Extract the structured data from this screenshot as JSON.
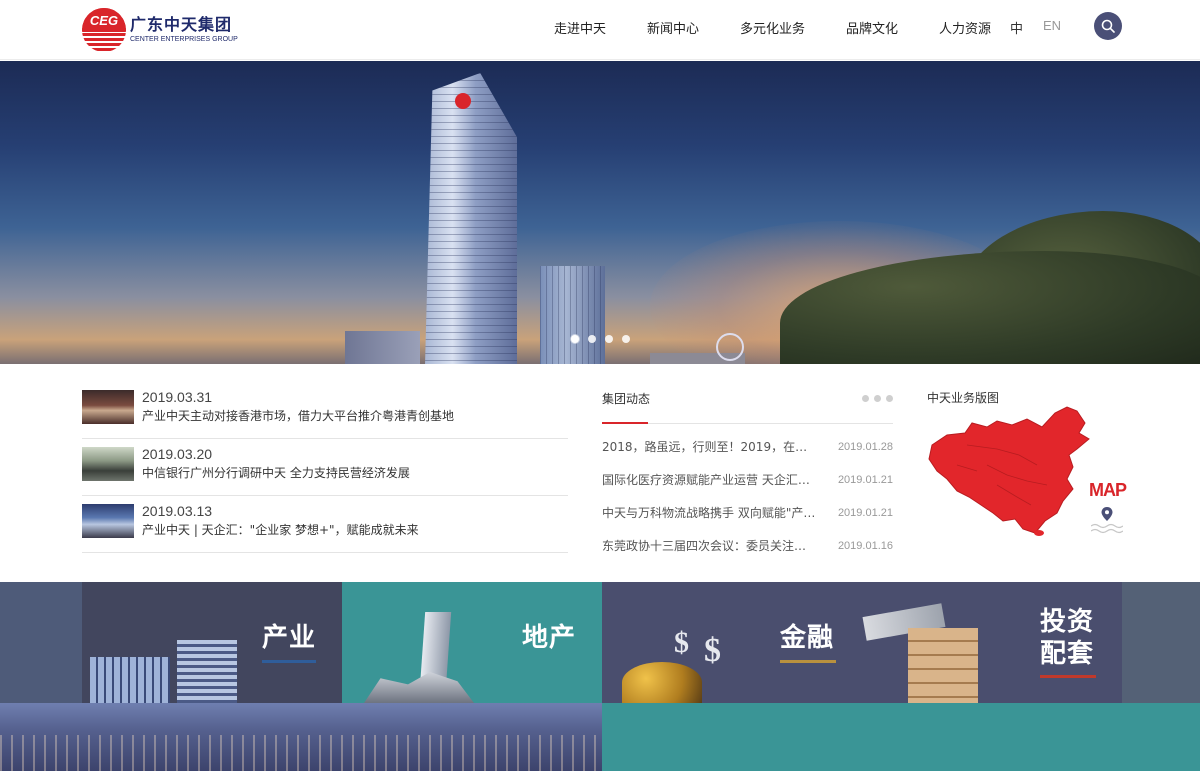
{
  "header": {
    "logo_abbr": "CEG",
    "logo_cn": "广东中天集团",
    "logo_en": "CENTER ENTERPRISES GROUP",
    "nav": [
      "走进中天",
      "新闻中心",
      "多元化业务",
      "品牌文化",
      "人力资源"
    ],
    "lang_cn": "中",
    "lang_en": "EN"
  },
  "hero": {
    "slide_count": 4,
    "active_slide": 1
  },
  "news": [
    {
      "date": "2019.03.31",
      "title": "产业中天主动对接香港市场，借力大平台推介粤港青创基地"
    },
    {
      "date": "2019.03.20",
      "title": "中信银行广州分行调研中天 全力支持民营经济发展"
    },
    {
      "date": "2019.03.13",
      "title": "产业中天 | 天企汇：\"企业家 梦想+\"，赋能成就未来"
    }
  ],
  "group_news": {
    "title": "集团动态",
    "items": [
      {
        "title": "2018，路虽远，行则至！2019，在一起…",
        "date": "2019.01.28"
      },
      {
        "title": "国际化医疗资源赋能产业运营 天企汇…",
        "date": "2019.01.21"
      },
      {
        "title": "中天与万科物流战略携手 双向赋能\"产…",
        "date": "2019.01.21"
      },
      {
        "title": "东莞政协十三届四次会议：委员关注…",
        "date": "2019.01.16"
      }
    ]
  },
  "map": {
    "title": "中天业务版图",
    "label": "MAP"
  },
  "business": {
    "industry": "产业",
    "real_estate": "地产",
    "finance": "金融",
    "investment_1": "投资",
    "investment_2": "配套"
  },
  "colors": {
    "brand_red": "#d9252a",
    "navy": "#1f2a6b",
    "teal": "#3a9596",
    "slate": "#4a4e6e"
  }
}
